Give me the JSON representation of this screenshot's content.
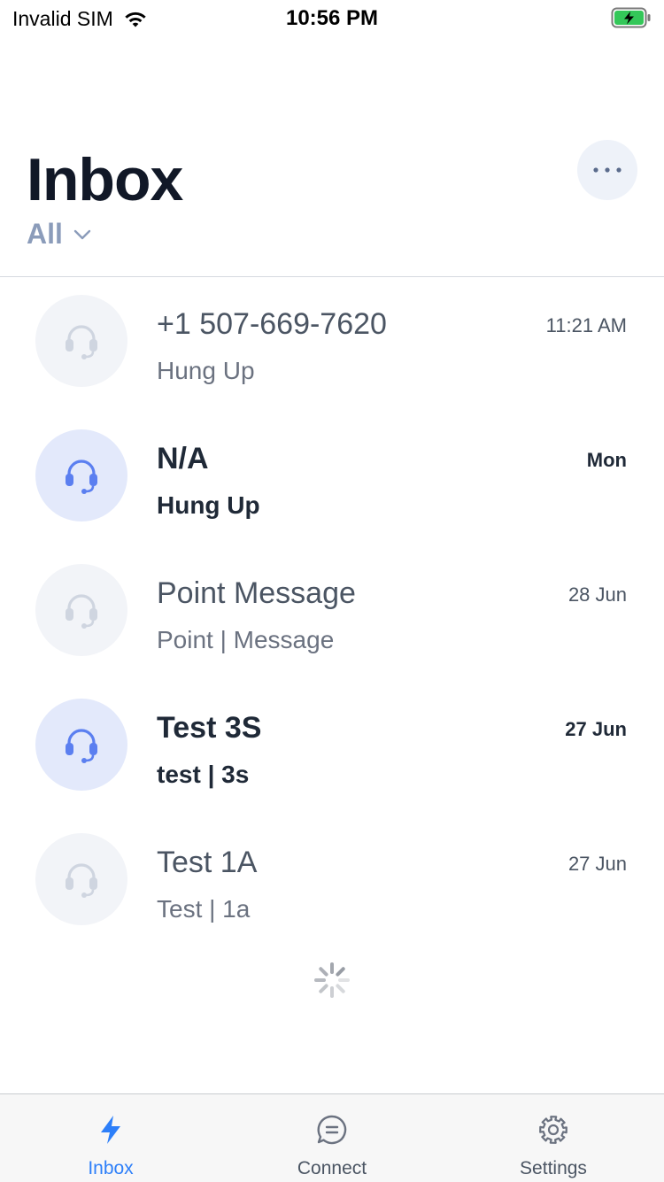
{
  "status_bar": {
    "carrier": "Invalid SIM",
    "time": "10:56 PM",
    "wifi_icon": "wifi-icon",
    "battery_icon": "battery-charging-icon"
  },
  "header": {
    "title": "Inbox",
    "filter_label": "All",
    "more_icon": "ellipsis-icon"
  },
  "conversations": [
    {
      "name": "+1 507-669-7620",
      "preview": "Hung Up",
      "time": "11:21 AM",
      "unread": false,
      "icon": "headset-icon"
    },
    {
      "name": "N/A",
      "preview": "Hung Up",
      "time": "Mon",
      "unread": true,
      "icon": "headset-icon"
    },
    {
      "name": "Point Message",
      "preview": "Point | Message",
      "time": "28 Jun",
      "unread": false,
      "icon": "headset-icon"
    },
    {
      "name": "Test 3S",
      "preview": "test | 3s",
      "time": "27 Jun",
      "unread": true,
      "icon": "headset-icon"
    },
    {
      "name": "Test 1A",
      "preview": "Test | 1a",
      "time": "27 Jun",
      "unread": false,
      "icon": "headset-icon"
    }
  ],
  "tabs": [
    {
      "label": "Inbox",
      "icon": "lightning-icon",
      "active": true
    },
    {
      "label": "Connect",
      "icon": "chat-bubble-icon",
      "active": false
    },
    {
      "label": "Settings",
      "icon": "gear-icon",
      "active": false
    }
  ],
  "colors": {
    "accent": "#2d7ff9",
    "unread_avatar_bg": "#e3e9fb",
    "unread_icon": "#5b7ff0",
    "read_icon": "#cfd5e0",
    "filter": "#8b9cba"
  }
}
